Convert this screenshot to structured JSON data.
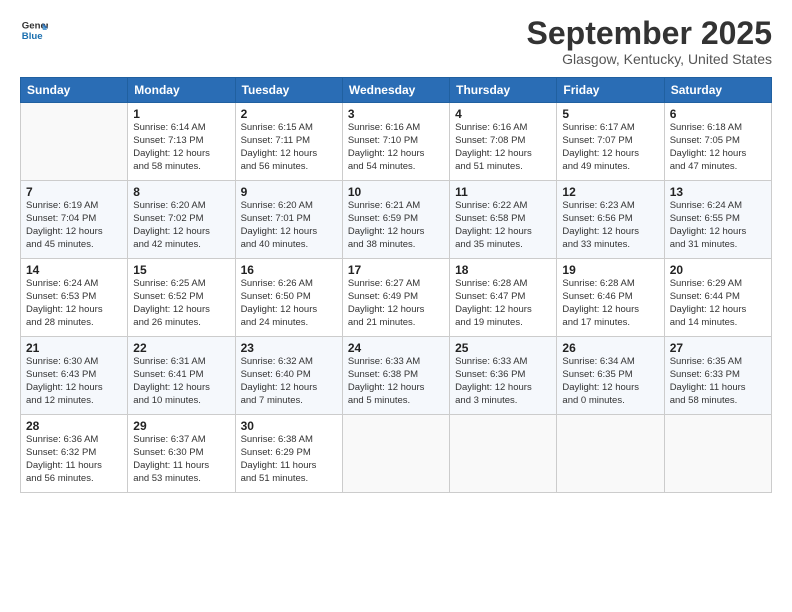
{
  "header": {
    "logo_line1": "General",
    "logo_line2": "Blue",
    "month_title": "September 2025",
    "location": "Glasgow, Kentucky, United States"
  },
  "weekdays": [
    "Sunday",
    "Monday",
    "Tuesday",
    "Wednesday",
    "Thursday",
    "Friday",
    "Saturday"
  ],
  "weeks": [
    [
      {
        "day": "",
        "info": ""
      },
      {
        "day": "1",
        "info": "Sunrise: 6:14 AM\nSunset: 7:13 PM\nDaylight: 12 hours\nand 58 minutes."
      },
      {
        "day": "2",
        "info": "Sunrise: 6:15 AM\nSunset: 7:11 PM\nDaylight: 12 hours\nand 56 minutes."
      },
      {
        "day": "3",
        "info": "Sunrise: 6:16 AM\nSunset: 7:10 PM\nDaylight: 12 hours\nand 54 minutes."
      },
      {
        "day": "4",
        "info": "Sunrise: 6:16 AM\nSunset: 7:08 PM\nDaylight: 12 hours\nand 51 minutes."
      },
      {
        "day": "5",
        "info": "Sunrise: 6:17 AM\nSunset: 7:07 PM\nDaylight: 12 hours\nand 49 minutes."
      },
      {
        "day": "6",
        "info": "Sunrise: 6:18 AM\nSunset: 7:05 PM\nDaylight: 12 hours\nand 47 minutes."
      }
    ],
    [
      {
        "day": "7",
        "info": "Sunrise: 6:19 AM\nSunset: 7:04 PM\nDaylight: 12 hours\nand 45 minutes."
      },
      {
        "day": "8",
        "info": "Sunrise: 6:20 AM\nSunset: 7:02 PM\nDaylight: 12 hours\nand 42 minutes."
      },
      {
        "day": "9",
        "info": "Sunrise: 6:20 AM\nSunset: 7:01 PM\nDaylight: 12 hours\nand 40 minutes."
      },
      {
        "day": "10",
        "info": "Sunrise: 6:21 AM\nSunset: 6:59 PM\nDaylight: 12 hours\nand 38 minutes."
      },
      {
        "day": "11",
        "info": "Sunrise: 6:22 AM\nSunset: 6:58 PM\nDaylight: 12 hours\nand 35 minutes."
      },
      {
        "day": "12",
        "info": "Sunrise: 6:23 AM\nSunset: 6:56 PM\nDaylight: 12 hours\nand 33 minutes."
      },
      {
        "day": "13",
        "info": "Sunrise: 6:24 AM\nSunset: 6:55 PM\nDaylight: 12 hours\nand 31 minutes."
      }
    ],
    [
      {
        "day": "14",
        "info": "Sunrise: 6:24 AM\nSunset: 6:53 PM\nDaylight: 12 hours\nand 28 minutes."
      },
      {
        "day": "15",
        "info": "Sunrise: 6:25 AM\nSunset: 6:52 PM\nDaylight: 12 hours\nand 26 minutes."
      },
      {
        "day": "16",
        "info": "Sunrise: 6:26 AM\nSunset: 6:50 PM\nDaylight: 12 hours\nand 24 minutes."
      },
      {
        "day": "17",
        "info": "Sunrise: 6:27 AM\nSunset: 6:49 PM\nDaylight: 12 hours\nand 21 minutes."
      },
      {
        "day": "18",
        "info": "Sunrise: 6:28 AM\nSunset: 6:47 PM\nDaylight: 12 hours\nand 19 minutes."
      },
      {
        "day": "19",
        "info": "Sunrise: 6:28 AM\nSunset: 6:46 PM\nDaylight: 12 hours\nand 17 minutes."
      },
      {
        "day": "20",
        "info": "Sunrise: 6:29 AM\nSunset: 6:44 PM\nDaylight: 12 hours\nand 14 minutes."
      }
    ],
    [
      {
        "day": "21",
        "info": "Sunrise: 6:30 AM\nSunset: 6:43 PM\nDaylight: 12 hours\nand 12 minutes."
      },
      {
        "day": "22",
        "info": "Sunrise: 6:31 AM\nSunset: 6:41 PM\nDaylight: 12 hours\nand 10 minutes."
      },
      {
        "day": "23",
        "info": "Sunrise: 6:32 AM\nSunset: 6:40 PM\nDaylight: 12 hours\nand 7 minutes."
      },
      {
        "day": "24",
        "info": "Sunrise: 6:33 AM\nSunset: 6:38 PM\nDaylight: 12 hours\nand 5 minutes."
      },
      {
        "day": "25",
        "info": "Sunrise: 6:33 AM\nSunset: 6:36 PM\nDaylight: 12 hours\nand 3 minutes."
      },
      {
        "day": "26",
        "info": "Sunrise: 6:34 AM\nSunset: 6:35 PM\nDaylight: 12 hours\nand 0 minutes."
      },
      {
        "day": "27",
        "info": "Sunrise: 6:35 AM\nSunset: 6:33 PM\nDaylight: 11 hours\nand 58 minutes."
      }
    ],
    [
      {
        "day": "28",
        "info": "Sunrise: 6:36 AM\nSunset: 6:32 PM\nDaylight: 11 hours\nand 56 minutes."
      },
      {
        "day": "29",
        "info": "Sunrise: 6:37 AM\nSunset: 6:30 PM\nDaylight: 11 hours\nand 53 minutes."
      },
      {
        "day": "30",
        "info": "Sunrise: 6:38 AM\nSunset: 6:29 PM\nDaylight: 11 hours\nand 51 minutes."
      },
      {
        "day": "",
        "info": ""
      },
      {
        "day": "",
        "info": ""
      },
      {
        "day": "",
        "info": ""
      },
      {
        "day": "",
        "info": ""
      }
    ]
  ]
}
